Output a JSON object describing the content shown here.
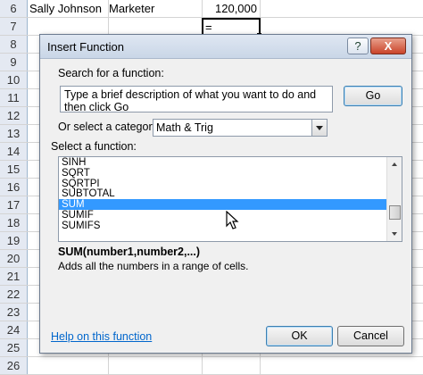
{
  "sheet": {
    "rows": [
      {
        "num": "6",
        "a": "Sally Johnson",
        "b": "Marketer",
        "c": "120,000"
      },
      {
        "num": "7",
        "a": "",
        "b": "",
        "c": ""
      },
      {
        "num": "8"
      },
      {
        "num": "9"
      },
      {
        "num": "10"
      },
      {
        "num": "11"
      },
      {
        "num": "12"
      },
      {
        "num": "13"
      },
      {
        "num": "14"
      },
      {
        "num": "15"
      },
      {
        "num": "16"
      },
      {
        "num": "17"
      },
      {
        "num": "18"
      },
      {
        "num": "19"
      },
      {
        "num": "20"
      },
      {
        "num": "21"
      },
      {
        "num": "22"
      },
      {
        "num": "23"
      },
      {
        "num": "24"
      },
      {
        "num": "25"
      },
      {
        "num": "26"
      }
    ],
    "active_cell_value": "="
  },
  "dialog": {
    "title": "Insert Function",
    "help_btn": "?",
    "close_btn": "X",
    "search_label": "Search for a function:",
    "search_value": "Type a brief description of what you want to do and then click Go",
    "go_label": "Go",
    "category_label": "Or select a category:",
    "category_value": "Math & Trig",
    "select_label": "Select a function:",
    "functions": [
      "SINH",
      "SQRT",
      "SQRTPI",
      "SUBTOTAL",
      "SUM",
      "SUMIF",
      "SUMIFS"
    ],
    "selected_function": "SUM",
    "signature": "SUM(number1,number2,...)",
    "description": "Adds all the numbers in a range of cells.",
    "help_link": "Help on this function",
    "ok_label": "OK",
    "cancel_label": "Cancel"
  },
  "colors": {
    "accent": "#3399ff",
    "link": "#0066cc"
  }
}
